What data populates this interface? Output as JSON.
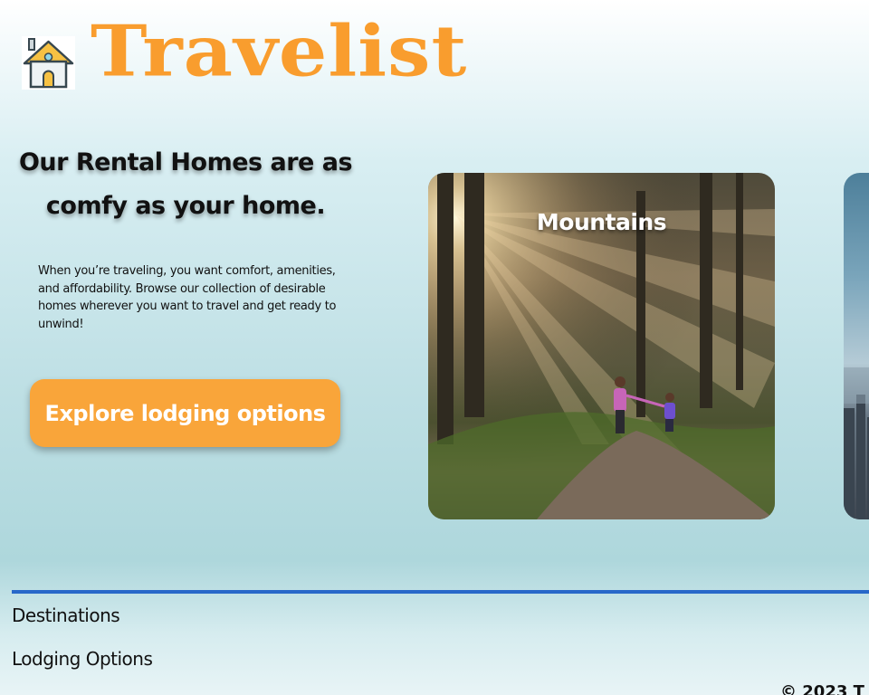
{
  "header": {
    "brand": "Travelist",
    "logo_icon": "house-icon"
  },
  "hero": {
    "tagline": "Our Rental Homes are as comfy as your home.",
    "intro": "When you’re traveling, you want comfort, amenities, and affordability. Browse our collection of desirable homes wherever you want to travel and get ready to unwind!",
    "cta_label": "Explore lodging options"
  },
  "carousel": {
    "cards": [
      {
        "title": "Mountains",
        "image": "forest-trail-photo"
      },
      {
        "title": "",
        "image": "city-skyline-photo"
      }
    ]
  },
  "footer": {
    "links": [
      {
        "label": "Destinations"
      },
      {
        "label": "Lodging Options"
      }
    ],
    "copyright": "© 2023 T"
  },
  "colors": {
    "brand": "#f99d2e",
    "cta": "#f9a53a",
    "footer_rule": "#2868c9"
  }
}
